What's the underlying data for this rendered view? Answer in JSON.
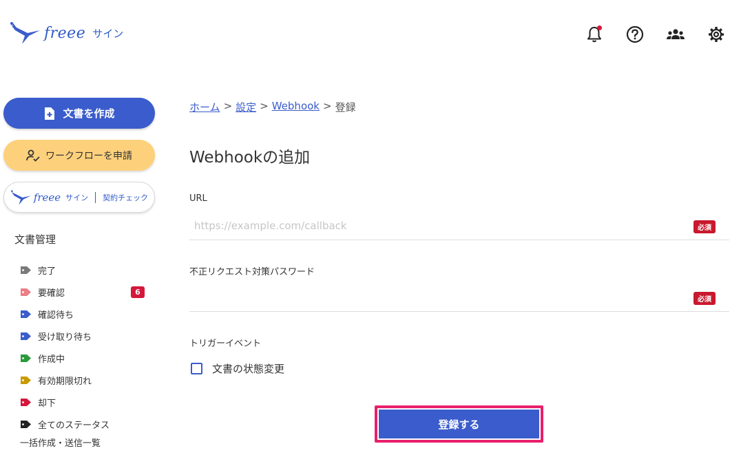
{
  "header": {
    "brand": "freee",
    "product": "サイン",
    "icons": [
      "bell-icon",
      "help-icon",
      "users-icon",
      "settings-icon"
    ],
    "has_notification": true
  },
  "sidebar": {
    "create_button": "文書を作成",
    "workflow_button": "ワークフローを申請",
    "contract_check": {
      "brand": "freee",
      "product": "サイン",
      "label": "契約チェック"
    },
    "section_title": "文書管理",
    "statuses": [
      {
        "label": "完了",
        "color": "#7a7a7a"
      },
      {
        "label": "要確認",
        "color": "#ec7e85",
        "badge": "6"
      },
      {
        "label": "確認待ち",
        "color": "#3a5ccc"
      },
      {
        "label": "受け取り待ち",
        "color": "#3a5ccc"
      },
      {
        "label": "作成中",
        "color": "#2a9a3a"
      },
      {
        "label": "有効期限切れ",
        "color": "#c89a00"
      },
      {
        "label": "却下",
        "color": "#d4173b"
      },
      {
        "label": "全てのステータス",
        "color": "#222222"
      }
    ],
    "bulk_link": "一括作成・送信一覧"
  },
  "breadcrumb": {
    "items": [
      "ホーム",
      "設定",
      "Webhook"
    ],
    "current": "登録",
    "separator": ">"
  },
  "main": {
    "title": "Webhookの追加",
    "url_label": "URL",
    "url_placeholder": "https://example.com/callback",
    "url_value": "",
    "password_label": "不正リクエスト対策パスワード",
    "password_value": "",
    "required_label": "必須",
    "trigger_label": "トリガーイベント",
    "trigger_option": "文書の状態変更",
    "trigger_checked": false,
    "submit_label": "登録する"
  },
  "colors": {
    "primary": "#3a5ccc",
    "accent_yellow": "#fdd17c",
    "required_red": "#c8192e",
    "highlight": "#e8206a"
  }
}
